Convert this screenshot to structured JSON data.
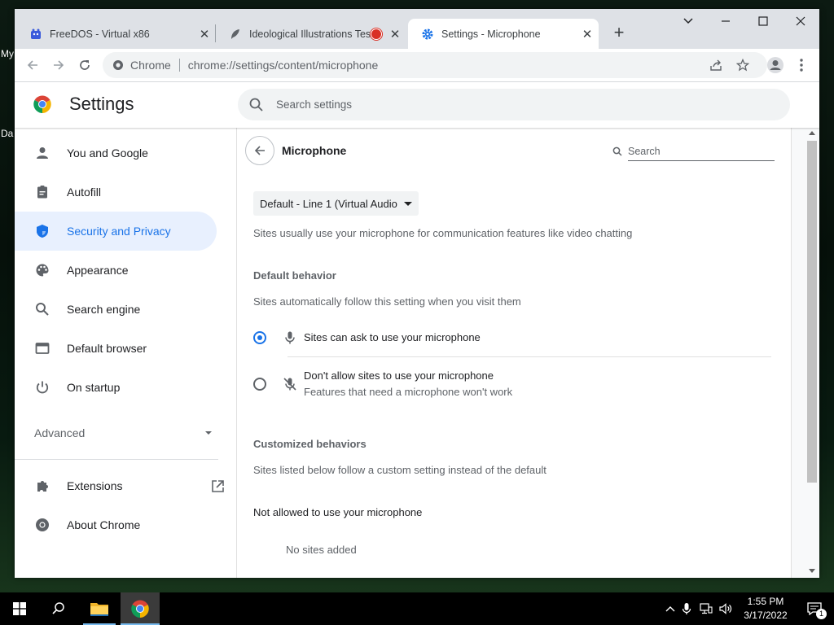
{
  "desktop": {
    "label_1": "My",
    "label_2": "Da"
  },
  "browser": {
    "tabs": [
      {
        "title": "FreeDOS - Virtual x86"
      },
      {
        "title": "Ideological Illustrations Test"
      },
      {
        "title": "Settings - Microphone"
      }
    ],
    "new_tab_symbol": "+",
    "omnibox": {
      "site_label": "Chrome",
      "url": "chrome://settings/content/microphone"
    }
  },
  "settings": {
    "title": "Settings",
    "search_placeholder": "Search settings",
    "nav": [
      {
        "label": "You and Google"
      },
      {
        "label": "Autofill"
      },
      {
        "label": "Security and Privacy"
      },
      {
        "label": "Appearance"
      },
      {
        "label": "Search engine"
      },
      {
        "label": "Default browser"
      },
      {
        "label": "On startup"
      }
    ],
    "advanced_label": "Advanced",
    "extensions_label": "Extensions",
    "about_label": "About Chrome"
  },
  "microphone": {
    "heading": "Microphone",
    "search_placeholder": "Search",
    "device_select": "Default - Line 1 (Virtual Audio",
    "intro": "Sites usually use your microphone for communication features like video chatting",
    "default_behavior_title": "Default behavior",
    "default_behavior_desc": "Sites automatically follow this setting when you visit them",
    "option_allow": "Sites can ask to use your microphone",
    "option_block": "Don't allow sites to use your microphone",
    "option_block_sub": "Features that need a microphone won't work",
    "customized_title": "Customized behaviors",
    "customized_desc": "Sites listed below follow a custom setting instead of the default",
    "not_allowed_title": "Not allowed to use your microphone",
    "no_sites": "No sites added"
  },
  "taskbar": {
    "time": "1:55 PM",
    "date": "3/17/2022",
    "notification_count": "1"
  },
  "colors": {
    "accent": "#1a73e8",
    "active_nav_bg": "#e8f0fe"
  }
}
